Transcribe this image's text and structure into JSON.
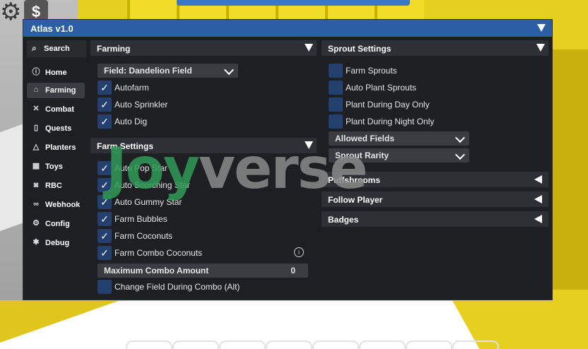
{
  "window": {
    "title": "Atlas v1.0"
  },
  "sidebar": {
    "search_label": "Search",
    "items": [
      {
        "label": "Home",
        "icon": "info-icon"
      },
      {
        "label": "Farming",
        "icon": "home-icon"
      },
      {
        "label": "Combat",
        "icon": "swords-icon"
      },
      {
        "label": "Quests",
        "icon": "book-icon"
      },
      {
        "label": "Planters",
        "icon": "triangle-icon"
      },
      {
        "label": "Toys",
        "icon": "calendar-icon"
      },
      {
        "label": "RBC",
        "icon": "robot-icon"
      },
      {
        "label": "Webhook",
        "icon": "link-icon"
      },
      {
        "label": "Config",
        "icon": "gear-icon"
      },
      {
        "label": "Debug",
        "icon": "bug-icon"
      }
    ],
    "active": "Farming"
  },
  "farming": {
    "title": "Farming",
    "field_dropdown": "Field: Dandelion Field",
    "options": [
      {
        "label": "Autofarm",
        "checked": true
      },
      {
        "label": "Auto Sprinkler",
        "checked": true
      },
      {
        "label": "Auto Dig",
        "checked": true
      }
    ]
  },
  "farm_settings": {
    "title": "Farm Settings",
    "options": [
      {
        "label": "Auto Pop Star",
        "checked": true
      },
      {
        "label": "Auto Scorching Star",
        "checked": true
      },
      {
        "label": "Auto Gummy Star",
        "checked": true
      },
      {
        "label": "Farm Bubbles",
        "checked": true
      },
      {
        "label": "Farm Coconuts",
        "checked": true
      },
      {
        "label": "Farm Combo Coconuts",
        "checked": true
      }
    ],
    "max_combo_label": "Maximum Combo Amount",
    "max_combo_value": "0",
    "change_field_label": "Change Field During Combo (Alt)",
    "change_field_checked": false
  },
  "sprout_settings": {
    "title": "Sprout Settings",
    "options": [
      {
        "label": "Farm Sprouts",
        "checked": false
      },
      {
        "label": "Auto Plant Sprouts",
        "checked": false
      },
      {
        "label": "Plant During Day Only",
        "checked": false
      },
      {
        "label": "Plant During Night Only",
        "checked": false
      }
    ],
    "allowed_fields": "Allowed Fields",
    "sprout_rarity": "Sprout Rarity"
  },
  "collapsed_sections": [
    "Puffshrooms",
    "Follow Player",
    "Badges"
  ],
  "checkmark": "✓",
  "watermark": {
    "part1": "Joy",
    "part2": "verse"
  },
  "colors": {
    "titlebar": "#2c5ea6",
    "checkbox": "#24406f",
    "background": "#1e1f22"
  }
}
